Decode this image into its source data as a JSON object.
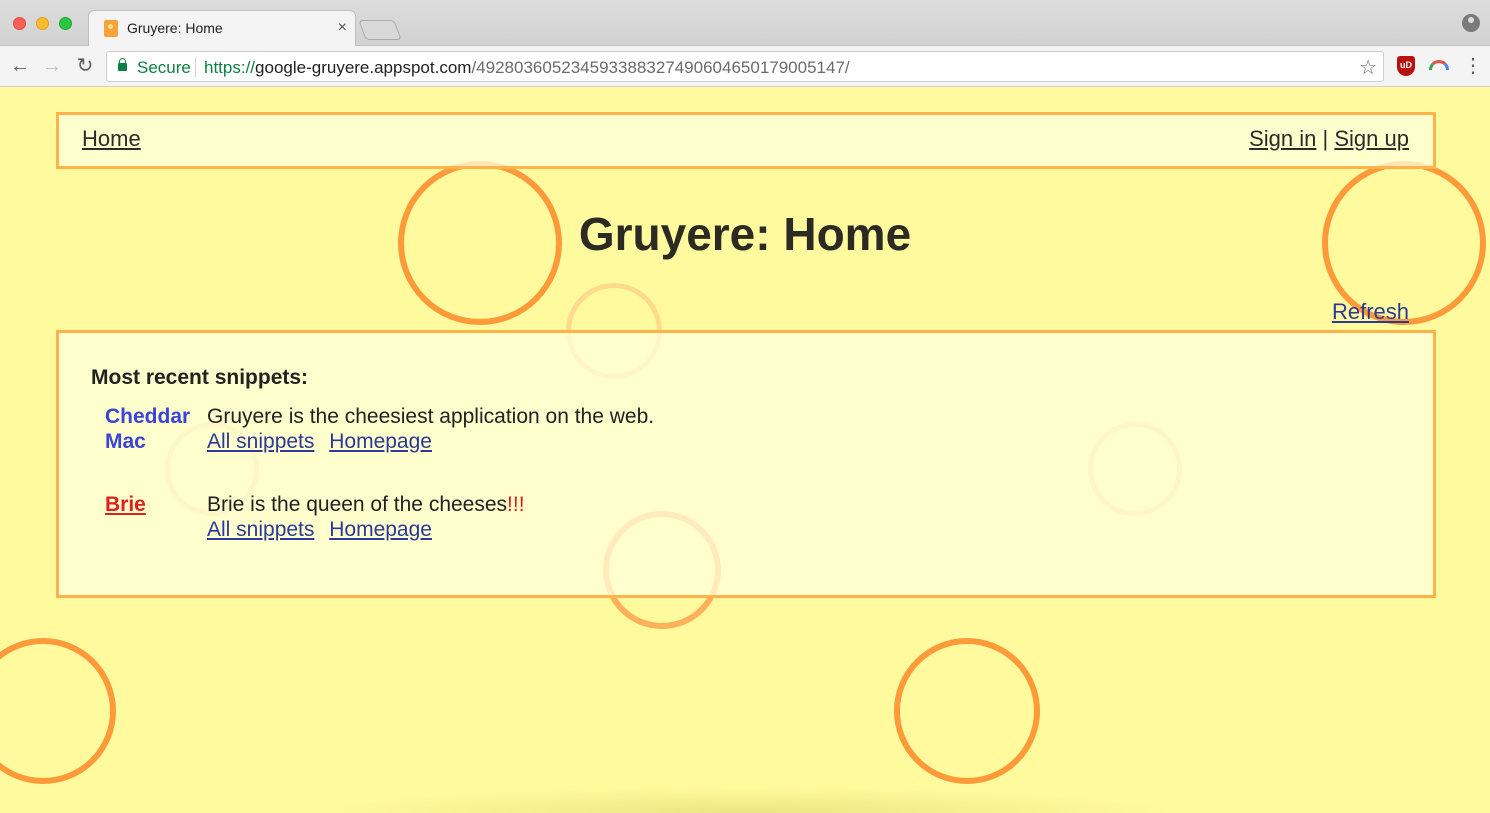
{
  "browser": {
    "tab_title": "Gruyere: Home",
    "tab_close": "×",
    "secure_label": "Secure",
    "url_scheme": "https://",
    "url_host": "google-gruyere.appspot.com",
    "url_path": "/492803605234593388327490604650179005147/",
    "back": "←",
    "forward": "→",
    "reload": "↻",
    "star": "☆",
    "menu": "⋮",
    "ext_label": "uD"
  },
  "nav": {
    "home": "Home",
    "sign_in": "Sign in",
    "separator": "|",
    "sign_up": "Sign up"
  },
  "page": {
    "title": "Gruyere: Home",
    "refresh": "Refresh"
  },
  "snippets_panel": {
    "heading": "Most recent snippets:",
    "items": [
      {
        "author_line1": "Cheddar",
        "author_line2": "Mac",
        "text": "Gruyere is the cheesiest application on the web.",
        "link_all": "All snippets",
        "link_home": "Homepage"
      },
      {
        "author_line1": "Brie",
        "text": "Brie is the queen of the cheeses",
        "text_emphasis": "!!!",
        "link_all": "All snippets",
        "link_home": "Homepage"
      }
    ]
  },
  "colors": {
    "background": "#fffa9e",
    "border": "#ffb34a",
    "bubble": "#ff9a3a",
    "author_blue": "#3b44d8",
    "author_red": "#e01f1f",
    "link": "#2b3a9a"
  }
}
